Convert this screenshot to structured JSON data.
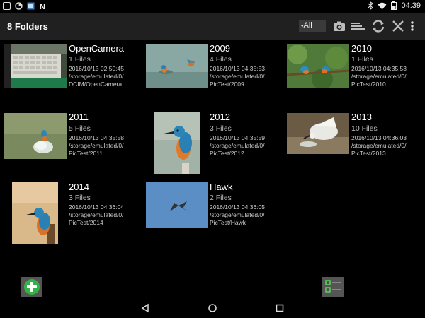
{
  "status": {
    "time": "04:39",
    "icons": [
      "square-icon",
      "circle-icon",
      "image-app-icon",
      "n-icon",
      "bluetooth-icon",
      "wifi-icon",
      "battery-icon"
    ]
  },
  "header": {
    "title": "8 Folders",
    "filter_value": "All",
    "actions": [
      "camera-icon",
      "sort-icon",
      "refresh-icon",
      "close-icon",
      "more-vert-icon"
    ]
  },
  "folders": [
    {
      "name": "OpenCamera",
      "count": "1 Files",
      "date": "2016/10/13 02:50:45",
      "path1": "/storage/emulated/0/",
      "path2": "DCIM/OpenCamera"
    },
    {
      "name": "2009",
      "count": "4 Files",
      "date": "2016/10/13 04:35:53",
      "path1": "/storage/emulated/0/",
      "path2": "PicTest/2009"
    },
    {
      "name": "2010",
      "count": "1 Files",
      "date": "2016/10/13 04:35:53",
      "path1": "/storage/emulated/0/",
      "path2": "PicTest/2010"
    },
    {
      "name": "2011",
      "count": "5 Files",
      "date": "2016/10/13 04:35:58",
      "path1": "/storage/emulated/0/",
      "path2": "PicTest/2011"
    },
    {
      "name": "2012",
      "count": "3 Files",
      "date": "2016/10/13 04:35:59",
      "path1": "/storage/emulated/0/",
      "path2": "PicTest/2012"
    },
    {
      "name": "2013",
      "count": "10 Files",
      "date": "2016/10/13 04:36:03",
      "path1": "/storage/emulated/0/",
      "path2": "PicTest/2013"
    },
    {
      "name": "2014",
      "count": "3 Files",
      "date": "2016/10/13 04:36:04",
      "path1": "/storage/emulated/0/",
      "path2": "PicTest/2014"
    },
    {
      "name": "Hawk",
      "count": "2 Files",
      "date": "2016/10/13 04:36:05",
      "path1": "/storage/emulated/0/",
      "path2": "PicTest/Hawk"
    }
  ],
  "colors": {
    "background": "#000000",
    "actionbar": "#202020",
    "add_green": "#33b347"
  }
}
